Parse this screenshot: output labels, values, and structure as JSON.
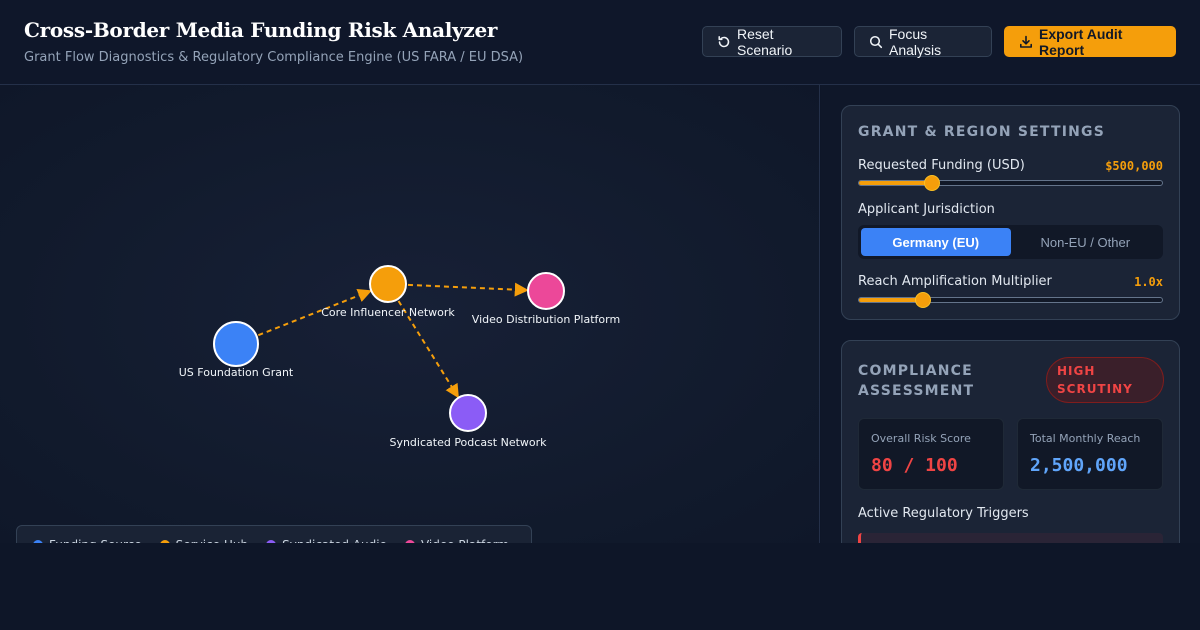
{
  "header": {
    "title": "Cross-Border Media Funding Risk Analyzer",
    "subtitle": "Grant Flow Diagnostics & Regulatory Compliance Engine (US FARA / EU DSA)",
    "buttons": {
      "reset_label": "Reset Scenario",
      "focus_label": "Focus Analysis",
      "export_label": "Export Audit Report"
    }
  },
  "graph": {
    "nodes": [
      {
        "id": "grant",
        "label": "US Foundation Grant",
        "color": "#3b82f6"
      },
      {
        "id": "hub",
        "label": "Core Influencer Network",
        "color": "#f59e0b"
      },
      {
        "id": "podcast",
        "label": "Syndicated Podcast Network",
        "color": "#8b5cf6"
      },
      {
        "id": "video",
        "label": "Video Distribution Platform",
        "color": "#ec4899"
      }
    ],
    "edges": [
      {
        "from": "grant",
        "to": "hub"
      },
      {
        "from": "hub",
        "to": "video"
      },
      {
        "from": "hub",
        "to": "podcast"
      }
    ],
    "edge_color": "#f59e0b"
  },
  "legend": {
    "items": [
      {
        "label": "Funding Source",
        "color": "#3b82f6"
      },
      {
        "label": "Service Hub",
        "color": "#f59e0b"
      },
      {
        "label": "Syndicated Audio",
        "color": "#8b5cf6"
      },
      {
        "label": "Video Platform",
        "color": "#ec4899"
      }
    ]
  },
  "settings": {
    "heading": "GRANT & REGION SETTINGS",
    "funding_label": "Requested Funding (USD)",
    "funding_value": "$500,000",
    "funding_slider_fraction": 0.24,
    "jurisdiction_label": "Applicant Jurisdiction",
    "jurisdiction_options": [
      "Germany (EU)",
      "Non-EU / Other"
    ],
    "jurisdiction_selected": "Germany (EU)",
    "multiplier_label": "Reach Amplification Multiplier",
    "multiplier_value": "1.0x",
    "multiplier_slider_fraction": 0.21
  },
  "compliance": {
    "heading_line1": "COMPLIANCE",
    "heading_line2": "ASSESSMENT",
    "badge_line1": "HIGH",
    "badge_line2": "SCRUTINY",
    "risk_label": "Overall Risk Score",
    "risk_value": "80 / 100",
    "reach_label": "Total Monthly Reach",
    "reach_value": "2,500,000",
    "triggers_label": "Active Regulatory Triggers",
    "risk_color": "#ef4444",
    "reach_color": "#60a5fa"
  }
}
